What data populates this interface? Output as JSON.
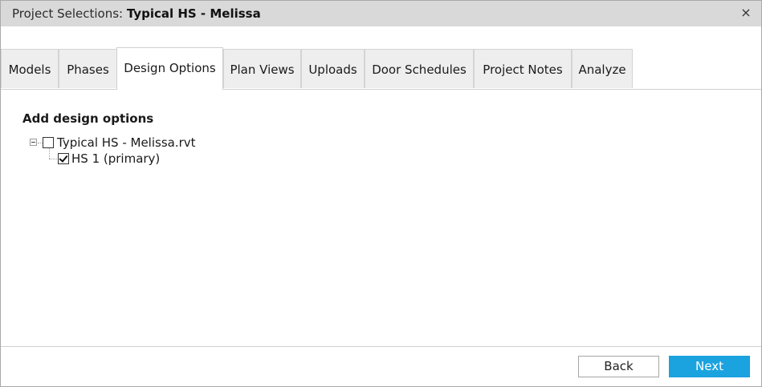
{
  "window": {
    "title_prefix": "Project Selections: ",
    "title_name": "Typical HS - Melissa",
    "close_glyph": "×"
  },
  "tabs": [
    {
      "label": "Models"
    },
    {
      "label": "Phases"
    },
    {
      "label": "Design Options",
      "active": true
    },
    {
      "label": "Plan Views"
    },
    {
      "label": "Uploads"
    },
    {
      "label": "Door Schedules"
    },
    {
      "label": "Project Notes"
    },
    {
      "label": "Analyze"
    }
  ],
  "main": {
    "section_title": "Add design options",
    "tree": {
      "root": {
        "label": "Typical HS - Melissa.rvt",
        "checked": false,
        "expanded": true
      },
      "children": [
        {
          "label": "HS 1 (primary)",
          "checked": true
        }
      ]
    }
  },
  "footer": {
    "back_label": "Back",
    "next_label": "Next"
  },
  "colors": {
    "titlebar_bg": "#d9d9d9",
    "tab_bg": "#eeeeee",
    "accent": "#1ba3e0"
  }
}
